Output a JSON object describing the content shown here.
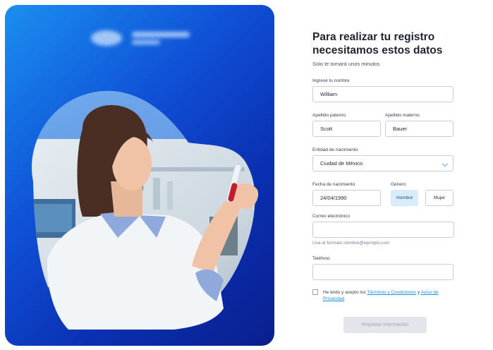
{
  "hero": {
    "brand_logo": "blurred-brand-logo",
    "image": "lab-scientist-with-test-tube"
  },
  "form": {
    "title": "Para realizar tu registro necesitamos estos datos",
    "subtitle": "Solo te tomará unos minutos",
    "first_name": {
      "label": "Ingresé tu nombre",
      "value": "William"
    },
    "last_name_paternal": {
      "label": "Apellido paterno",
      "value": "Scott"
    },
    "last_name_maternal": {
      "label": "Apellido materno",
      "value": "Bauer"
    },
    "birth_state": {
      "label": "Entidad de nacimiento",
      "value": "Ciudad de México"
    },
    "birth_date": {
      "label": "Fecha de nacimiento",
      "value": "24/04/1990"
    },
    "gender": {
      "label": "Género",
      "options": [
        "Hombre",
        "Mujer"
      ],
      "selected": "Hombre"
    },
    "email": {
      "label": "Correo electrónico",
      "value": "",
      "hint": "Usa el formato nombre@ejemplo.com"
    },
    "phone": {
      "label": "Teléfono",
      "value": ""
    },
    "terms": {
      "prefix": "He leído y acepto los ",
      "terms_link": "Términos y Condiciones",
      "connector": " y ",
      "privacy_link": "Aviso de Privacidad",
      "checked": false
    },
    "submit_label": "Registrar información"
  },
  "colors": {
    "hero_gradient_start": "#1b8ff0",
    "hero_gradient_end": "#0a1f8e",
    "selected_option_bg": "#d9ecfb",
    "link": "#1a8fd8",
    "disabled_button_bg": "#e3e5ea"
  }
}
